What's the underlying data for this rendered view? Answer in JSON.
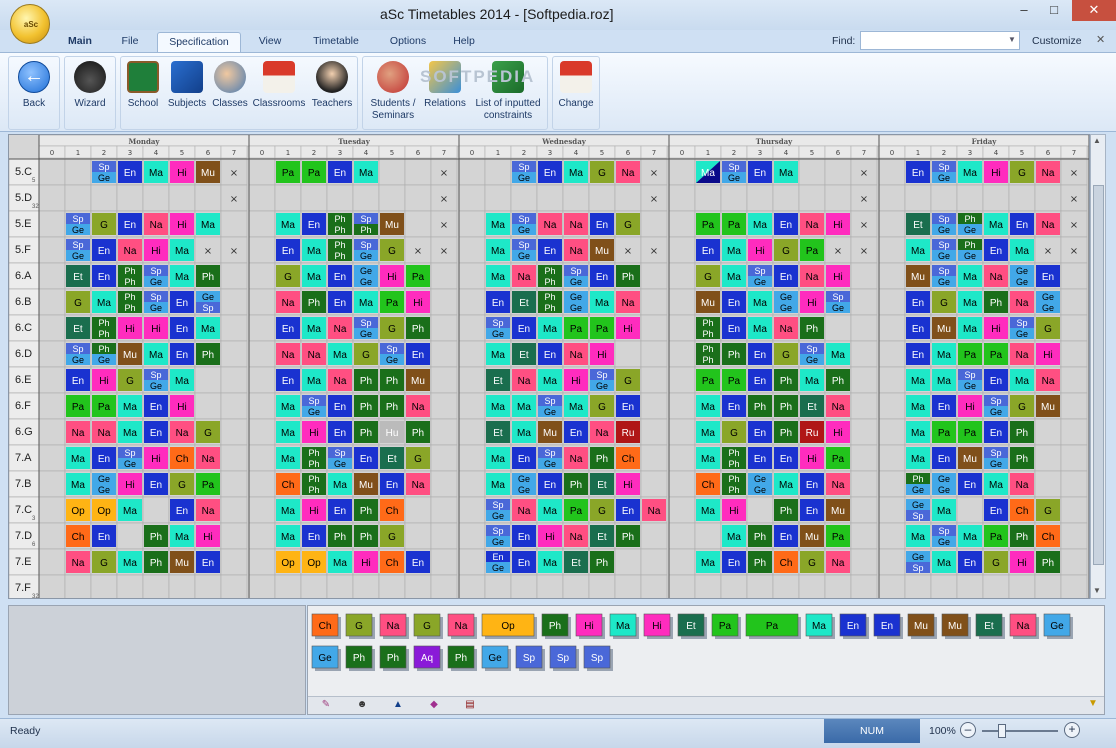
{
  "window": {
    "title": "aSc Timetables 2014  - [Softpedia.roz]",
    "orb_label": "aSc"
  },
  "tabs": {
    "main": "Main",
    "file": "File",
    "specification": "Specification",
    "view": "View",
    "timetable": "Timetable",
    "options": "Options",
    "help": "Help"
  },
  "find": {
    "label": "Find:",
    "value": ""
  },
  "customize": "Customize",
  "ribbon": {
    "back": "Back",
    "wizard": "Wizard",
    "school": "School",
    "subjects": "Subjects",
    "classes": "Classes",
    "classrooms": "Classrooms",
    "teachers": "Teachers",
    "students": "Students /",
    "seminars": "Seminars",
    "relations": "Relations",
    "inputted_1": "List of inputted",
    "inputted_2": "constraints",
    "change": "Change",
    "watermark": "SOFTPEDIA"
  },
  "colors": {
    "Sp": "#4a68d8",
    "Ge": "#42a8e8",
    "Ph": "#1a6f1a",
    "En": "#1a32d0",
    "Ma": "#1ee8c8",
    "Hi": "#ff2cbe",
    "Mu": "#80501a",
    "Pa": "#22c41c",
    "G": "#8aa628",
    "Na": "#ff4f82",
    "Ch": "#ff6a18",
    "Et": "#1a6e4e",
    "Op": "#ffb414",
    "Ru": "#b01616",
    "Aq": "#8a1ad8",
    "blank": "#d8d8d8",
    "purple": "#7a22e0",
    "navy": "#0a0a8a",
    "maroon": "#7a0a0a",
    "cream": "#fff8d0"
  },
  "timetable": {
    "days": [
      "Monday",
      "Tuesday",
      "Wednesday",
      "Thursday",
      "Friday"
    ],
    "periods": [
      "0",
      "1",
      "2",
      "3",
      "4",
      "5",
      "6",
      "7"
    ],
    "rows": [
      {
        "label": "5.C",
        "sub": "5",
        "cells": [
          "",
          "",
          "Sp/Ge",
          "En",
          "Ma",
          "Hi",
          "Mu",
          "x",
          "",
          "Pa",
          "Pa",
          "En",
          "Ma",
          "",
          "",
          "x",
          "",
          "",
          "Sp/Ge",
          "En",
          "Ma",
          "G",
          "Na",
          "x",
          "",
          "Ma/x",
          "Sp/Ge",
          "En",
          "Ma",
          "",
          "",
          "x",
          "",
          "En",
          "Sp/Ge",
          "Ma",
          "Hi",
          "G",
          "Na",
          "x"
        ]
      },
      {
        "label": "5.D",
        "sub": "32",
        "cells": [
          "",
          "",
          "",
          "",
          "",
          "",
          "",
          "x",
          "",
          "",
          "",
          "",
          "",
          "",
          "",
          "x",
          "",
          "",
          "",
          "",
          "",
          "",
          "",
          "x",
          "",
          "",
          "",
          "",
          "",
          "",
          "",
          "x",
          "",
          "",
          "",
          "",
          "",
          "",
          "",
          "x"
        ]
      },
      {
        "label": "5.E",
        "sub": "",
        "cells": [
          "",
          "Sp/Ge",
          "G",
          "En",
          "Na",
          "Hi",
          "Ma",
          "",
          "",
          "Ma",
          "En",
          "Ph/Ph",
          "Sp/Ph",
          "Mu",
          "",
          "x",
          "",
          "Ma",
          "Sp/Ge",
          "Na",
          "Na",
          "En",
          "G",
          "",
          "",
          "Pa",
          "Pa",
          "Ma",
          "En",
          "Na",
          "Hi",
          "x",
          "",
          "Et",
          "Sp/Ge",
          "Ph/Ge",
          "Ma",
          "En",
          "Na",
          "x"
        ]
      },
      {
        "label": "5.F",
        "sub": "",
        "cells": [
          "",
          "Sp/Ge",
          "En",
          "Na",
          "Hi",
          "Ma",
          "x",
          "x",
          "",
          "En",
          "Ma",
          "Ph/Ph",
          "Sp/Ge",
          "G",
          "x",
          "x",
          "",
          "Ma",
          "Sp/Ge",
          "En",
          "Na",
          "Mu",
          "x",
          "x",
          "",
          "En",
          "Ma",
          "Hi",
          "G",
          "Pa",
          "x",
          "x",
          "",
          "Ma",
          "Sp/Ge",
          "Ph/Ge",
          "En",
          "Ma",
          "x",
          "x"
        ]
      },
      {
        "label": "6.A",
        "sub": "",
        "cells": [
          "",
          "Et",
          "En",
          "Ph/Ph",
          "Sp/Ge",
          "Ma",
          "Ph",
          "",
          "",
          "G",
          "Ma",
          "En",
          "Ge/Ge",
          "Hi",
          "Pa",
          "",
          "",
          "Ma",
          "Na",
          "Ph/Ph",
          "Sp/Ge",
          "En",
          "Ph",
          "",
          "",
          "G",
          "Ma",
          "Sp/Ge",
          "En",
          "Na",
          "Hi",
          "",
          "",
          "Mu",
          "Sp/Ge",
          "Ma",
          "Na",
          "Ge/Ge",
          "En",
          ""
        ]
      },
      {
        "label": "6.B",
        "sub": "",
        "cells": [
          "",
          "G",
          "Ma",
          "Ph/Ph",
          "Sp/Ge",
          "En",
          "Ge/Sp",
          "",
          "",
          "Na",
          "Ph",
          "En",
          "Ma",
          "Pa",
          "Hi",
          "",
          "",
          "En",
          "Et",
          "Ph/Ph",
          "Ge/Ge",
          "Ma",
          "Na",
          "",
          "",
          "Mu",
          "En",
          "Ma",
          "Ge/Ge",
          "Hi",
          "Sp/Ge",
          "",
          "",
          "En",
          "G",
          "Ma",
          "Ph",
          "Na",
          "Ge/Ge",
          ""
        ]
      },
      {
        "label": "6.C",
        "sub": "",
        "cells": [
          "",
          "Et",
          "Ph/Ph",
          "Hi",
          "Hi",
          "En",
          "Ma",
          "",
          "",
          "En",
          "Ma",
          "Na",
          "Sp/Ge",
          "G",
          "Ph",
          "",
          "",
          "Sp/Ge",
          "En",
          "Ma",
          "Pa",
          "Pa",
          "Hi",
          "",
          "",
          "Ph/Ph",
          "En",
          "Ma",
          "Na",
          "Ph",
          "",
          "",
          "",
          "En",
          "Mu",
          "Ma",
          "Hi",
          "Sp/Ge",
          "G",
          ""
        ]
      },
      {
        "label": "6.D",
        "sub": "",
        "cells": [
          "",
          "Sp/Ge",
          "Ph/Ge",
          "Mu",
          "Ma",
          "En",
          "Ph",
          "",
          "",
          "Na",
          "Na",
          "Ma",
          "G",
          "Sp/Ge",
          "En",
          "",
          "",
          "Ma",
          "Et",
          "En",
          "Na",
          "Hi",
          "",
          "",
          "",
          "Ph/Ph",
          "Ph",
          "En",
          "G",
          "Sp/Ge",
          "Ma",
          "",
          "",
          "En",
          "Ma",
          "Pa",
          "Pa",
          "Na",
          "Hi",
          ""
        ]
      },
      {
        "label": "6.E",
        "sub": "",
        "cells": [
          "",
          "En",
          "Hi",
          "G",
          "Sp/Ge",
          "Ma",
          "",
          "",
          "",
          "En",
          "Ma",
          "Na",
          "Ph",
          "Ph",
          "Mu",
          "",
          "",
          "Et",
          "Na",
          "Ma",
          "Hi",
          "Sp/Ge",
          "G",
          "",
          "",
          "Pa",
          "Pa",
          "En",
          "Ph",
          "Ma",
          "Ph",
          "",
          "",
          "Ma",
          "Ma",
          "Sp/Ge",
          "En",
          "Ma",
          "Na",
          ""
        ]
      },
      {
        "label": "6.F",
        "sub": "",
        "cells": [
          "",
          "Pa",
          "Pa",
          "Ma",
          "En",
          "Hi",
          "",
          "",
          "",
          "Ma",
          "Sp/Ge",
          "En",
          "Ph",
          "Ph",
          "Na",
          "",
          "",
          "Ma",
          "Ma",
          "Sp/Ge",
          "Ma",
          "G",
          "En",
          "",
          "",
          "Ma",
          "En",
          "Ph",
          "Ph",
          "Et",
          "Na",
          "",
          "",
          "Ma",
          "En",
          "Hi",
          "Sp/Ge",
          "G",
          "Mu",
          ""
        ]
      },
      {
        "label": "6.G",
        "sub": "",
        "cells": [
          "",
          "Na",
          "Na",
          "Ma",
          "En",
          "Na",
          "G",
          "",
          "",
          "Ma",
          "Hi",
          "En",
          "Ph",
          "Hu",
          "Ph",
          "",
          "",
          "Et",
          "Ma",
          "Mu",
          "En",
          "Na",
          "Ru",
          "",
          "",
          "Ma",
          "G",
          "En",
          "Ph",
          "Ru",
          "Hi",
          "",
          "",
          "Ma",
          "Pa",
          "Pa",
          "En",
          "Ph",
          "",
          ""
        ]
      },
      {
        "label": "7.A",
        "sub": "",
        "cells": [
          "",
          "Ma",
          "En",
          "Sp/Ge",
          "Hi",
          "Ch",
          "Na",
          "",
          "",
          "Ma",
          "Ph/Ph",
          "Sp/Ge",
          "En",
          "Et",
          "G",
          "",
          "",
          "Ma",
          "En",
          "Sp/Ge",
          "Na",
          "Ph",
          "Ch",
          "",
          "",
          "Ma",
          "Ph/Ph",
          "En",
          "En",
          "Hi",
          "Pa",
          "",
          "",
          "Ma",
          "En",
          "Mu",
          "Sp/Ge",
          "Ph",
          "",
          ""
        ]
      },
      {
        "label": "7.B",
        "sub": "",
        "cells": [
          "",
          "Ma",
          "Ge/Ge",
          "Hi",
          "En",
          "G",
          "Pa",
          "",
          "",
          "Ch",
          "Ph/Ph",
          "Ma",
          "Mu",
          "En",
          "Na",
          "",
          "",
          "Ma",
          "Ge/Ge",
          "En",
          "Ph",
          "Et",
          "Hi",
          "",
          "",
          "Ch",
          "Ph/Ph",
          "Ge/Ge",
          "Ma",
          "En",
          "Na",
          "",
          "",
          "Ph/Ge",
          "Ge/Ge",
          "En",
          "Ma",
          "Na",
          "",
          ""
        ]
      },
      {
        "label": "7.C",
        "sub": "3",
        "cells": [
          "",
          "Op",
          "Op",
          "Ma",
          "",
          "En",
          "Na",
          "",
          "",
          "Ma",
          "Hi",
          "En",
          "Ph",
          "Ch",
          "",
          "",
          "",
          "Sp/Ge",
          "Na",
          "Ma",
          "Pa",
          "G",
          "En",
          "Na",
          "",
          "Ma",
          "Hi",
          "",
          "Ph",
          "En",
          "Mu",
          "",
          "",
          "Ge/Sp",
          "Ma",
          "",
          "En",
          "Ch",
          "G",
          ""
        ]
      },
      {
        "label": "7.D",
        "sub": "6",
        "cells": [
          "",
          "Ch",
          "En",
          "",
          "Ph",
          "Ma",
          "Hi",
          "",
          "",
          "Ma",
          "En",
          "Ph",
          "Ph",
          "G",
          "",
          "",
          "",
          "Sp/Ge",
          "En",
          "Hi",
          "Na",
          "Et",
          "Ph",
          "",
          "",
          "",
          "Ma",
          "Ph",
          "En",
          "Mu",
          "Pa",
          "",
          "",
          "Ma",
          "Sp/Ge",
          "Ma",
          "Pa",
          "Ph",
          "Ch",
          ""
        ]
      },
      {
        "label": "7.E",
        "sub": "",
        "cells": [
          "",
          "Na",
          "G",
          "Ma",
          "Ph",
          "Mu",
          "En",
          "",
          "",
          "Op",
          "Op",
          "Ma",
          "Hi",
          "Ch",
          "En",
          "",
          "",
          "En/Ge",
          "En",
          "Ma",
          "Et",
          "Ph",
          "",
          "",
          "",
          "Ma",
          "En",
          "Ph",
          "Ch",
          "G",
          "Na",
          "",
          "",
          "Ge/Sp",
          "Ma",
          "En",
          "G",
          "Hi",
          "Ph",
          ""
        ]
      },
      {
        "label": "7.F",
        "sub": "32",
        "cells": [
          "",
          "",
          "",
          "",
          "",
          "",
          "",
          "",
          "",
          "",
          "",
          "",
          "",
          "",
          "",
          "",
          "",
          "",
          "",
          "",
          "",
          "",
          "",
          "",
          "",
          "",
          "",
          "",
          "",
          "",
          "",
          "",
          "",
          "",
          "",
          "",
          "",
          "",
          "",
          ""
        ]
      }
    ]
  },
  "unplaced_cards": [
    "Ch",
    "G",
    "Na",
    "G",
    "Na",
    "Op",
    "Ph",
    "Hi",
    "Ma",
    "Hi",
    "Et",
    "Pa",
    "Pa",
    "Ma",
    "En",
    "En",
    "Mu",
    "Mu",
    "Et",
    "Na",
    "Ge",
    "Ge",
    "Ph",
    "Ph",
    "Aq",
    "Ph",
    "Ge",
    "Sp",
    "Sp",
    "Sp"
  ],
  "cards_tab_icons": [
    "pencil-icon",
    "student-icon",
    "cap-icon",
    "eraser-icon",
    "desk-icon"
  ],
  "status": {
    "text": "Ready",
    "num": "NUM",
    "zoom": "100%"
  }
}
